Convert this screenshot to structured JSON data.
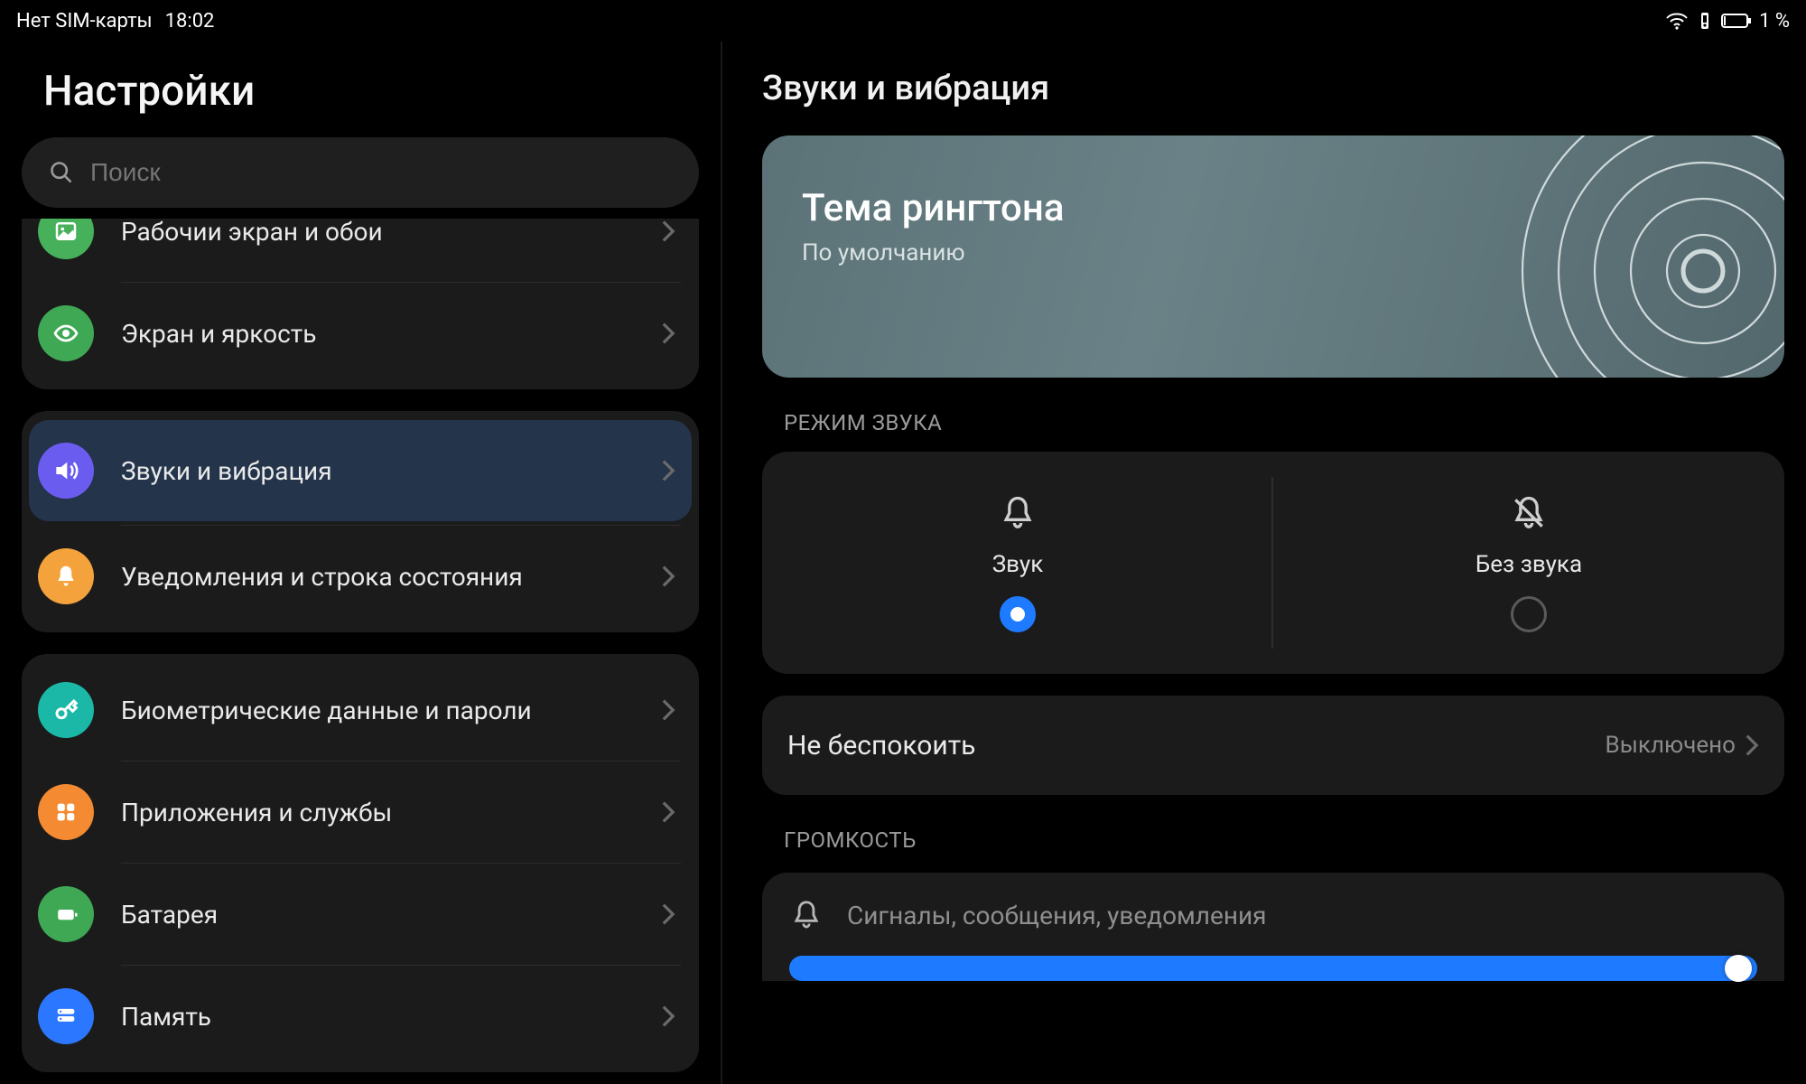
{
  "status": {
    "sim": "Нет SIM-карты",
    "time": "18:02",
    "battery_pct": "1 %"
  },
  "sidebar": {
    "title": "Настройки",
    "search_placeholder": "Поиск",
    "groups": [
      {
        "items": [
          {
            "id": "home-wallpaper",
            "label": "Рабочии экран и обои",
            "icon": "image-icon",
            "color": "#46b05b"
          },
          {
            "id": "display",
            "label": "Экран и яркость",
            "icon": "eye-icon",
            "color": "#3fa854"
          }
        ]
      },
      {
        "items": [
          {
            "id": "sound",
            "label": "Звуки и вибрация",
            "icon": "volume-icon",
            "color": "#6b5cf0",
            "selected": true
          },
          {
            "id": "notifications",
            "label": "Уведомления и строка состояния",
            "icon": "bell-icon",
            "color": "#f4a23c"
          }
        ]
      },
      {
        "items": [
          {
            "id": "biometrics",
            "label": "Биометрические данные и пароли",
            "icon": "key-icon",
            "color": "#1bb7a7"
          },
          {
            "id": "apps",
            "label": "Приложения и службы",
            "icon": "grid-icon",
            "color": "#f48a32"
          },
          {
            "id": "battery",
            "label": "Батарея",
            "icon": "battery-icon",
            "color": "#3fa854"
          },
          {
            "id": "storage",
            "label": "Память",
            "icon": "storage-icon",
            "color": "#2c77ff"
          }
        ]
      }
    ]
  },
  "content": {
    "title": "Звуки и вибрация",
    "ringtone": {
      "title": "Тема рингтона",
      "subtitle": "По умолчанию"
    },
    "sound_mode": {
      "section": "РЕЖИМ ЗВУКА",
      "option_sound": "Звук",
      "option_silent": "Без звука",
      "selected": "sound"
    },
    "dnd": {
      "label": "Не беспокоить",
      "value": "Выключено"
    },
    "volume": {
      "section": "ГРОМКОСТЬ",
      "row_label": "Сигналы, сообщения, уведомления",
      "value_pct": 100
    }
  }
}
